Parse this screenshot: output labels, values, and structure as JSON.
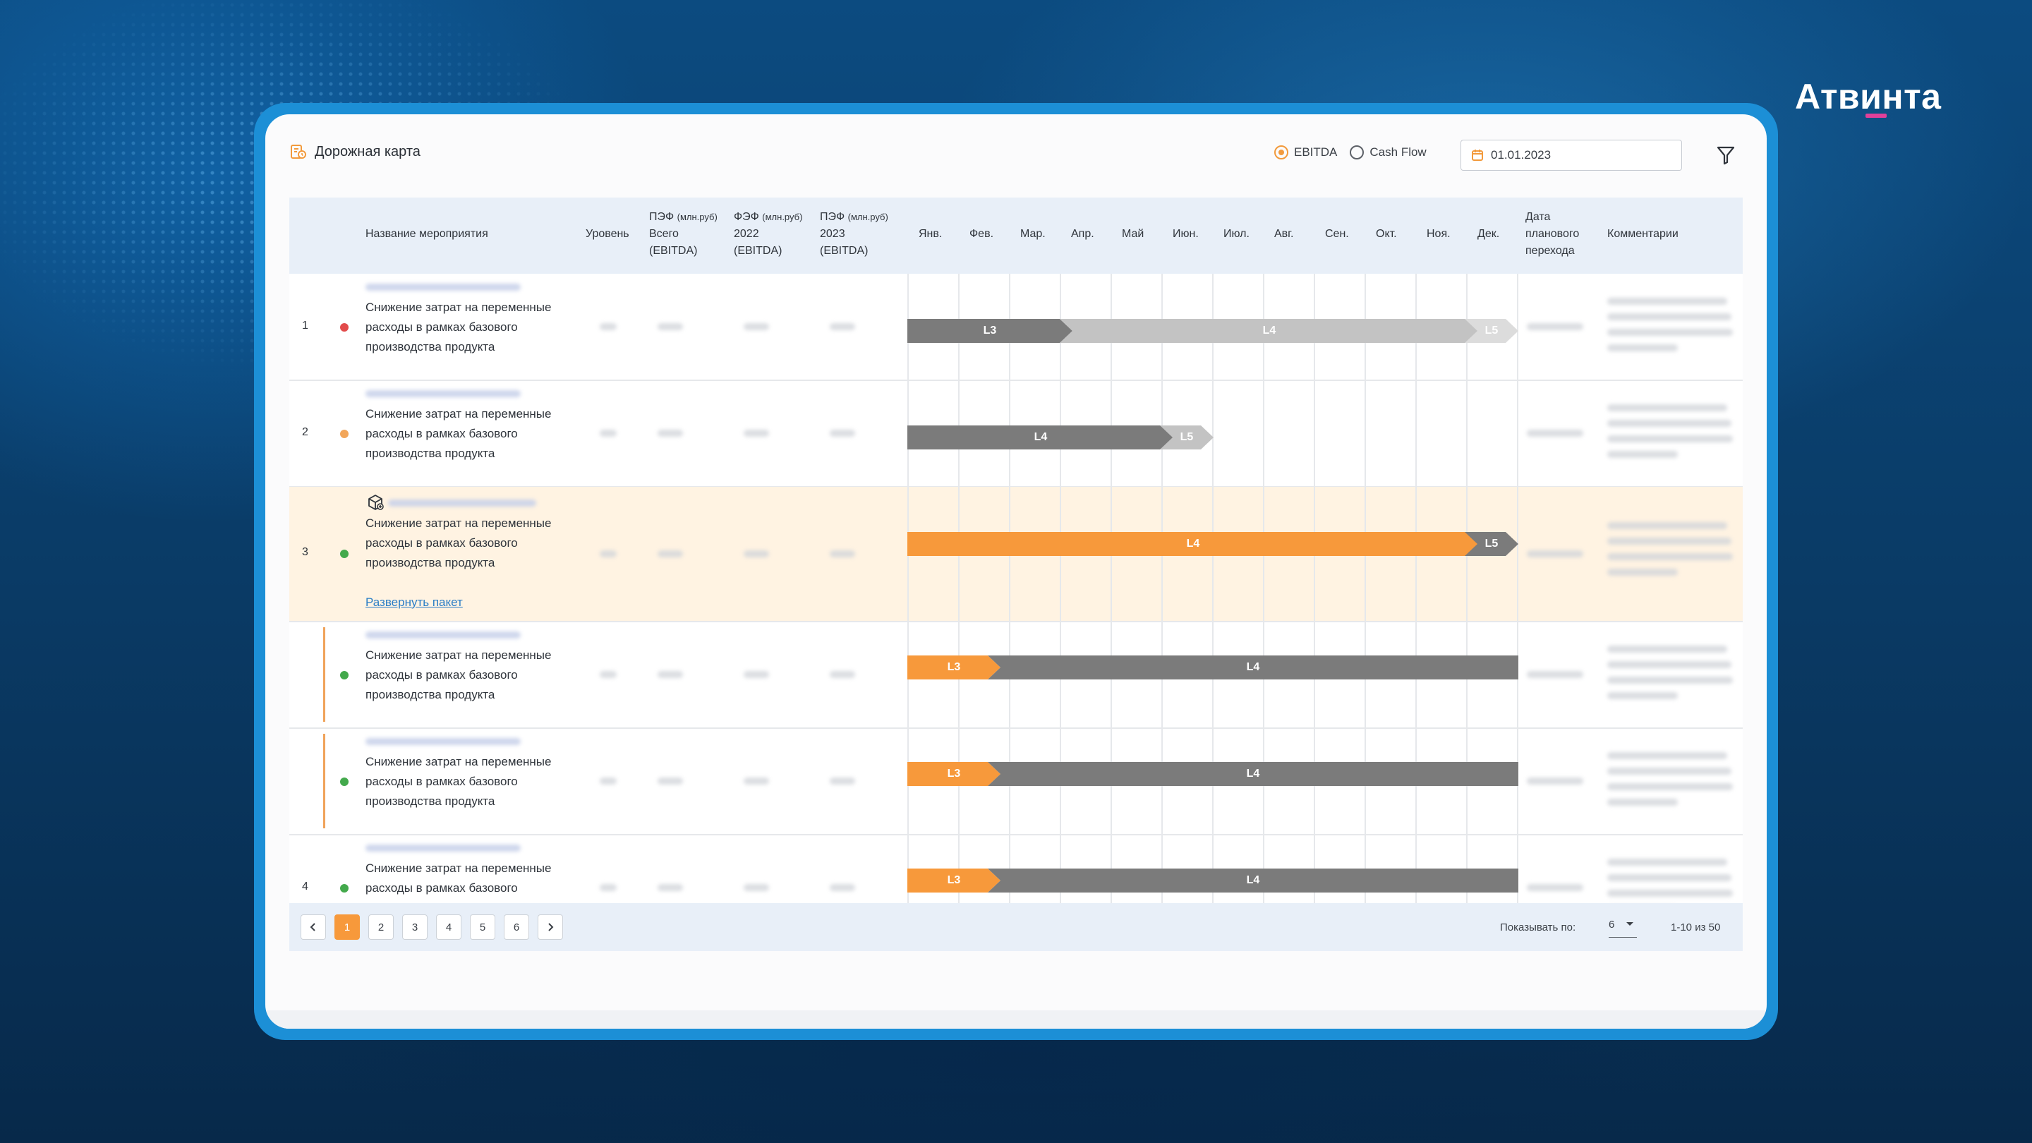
{
  "brand": {
    "logo_text": "Атвинта"
  },
  "header": {
    "title": "Дорожная карта",
    "radio_ebitda": "EBITDA",
    "radio_cashflow": "Cash Flow",
    "selected": "EBITDA",
    "date_value": "01.01.2023"
  },
  "columns": {
    "name": "Название мероприятия",
    "level": "Уровень",
    "pef_total_l1": "ПЭФ",
    "pef_total_unit": "(млн.руб)",
    "pef_total_l2": "Всего",
    "pef_total_l3": "(EBITDA)",
    "fef_2022_l1": "ФЭФ",
    "fef_2022_unit": "(млн.руб)",
    "fef_2022_l2": "2022",
    "fef_2022_l3": "(EBITDA)",
    "pef_2023_l1": "ПЭФ",
    "pef_2023_unit": "(млн.руб)",
    "pef_2023_l2": "2023",
    "pef_2023_l3": "(EBITDA)",
    "months": [
      "Янв.",
      "Фев.",
      "Мар.",
      "Апр.",
      "Май",
      "Июн.",
      "Июл.",
      "Авг.",
      "Сен.",
      "Окт.",
      "Ноя.",
      "Дек."
    ],
    "date_l1": "Дата",
    "date_l2": "планового",
    "date_l3": "перехода",
    "comments": "Комментарии"
  },
  "rows": [
    {
      "num": "1",
      "status": "red",
      "name": "Снижение затрат на переменные расходы в рамках базового производства продукта"
    },
    {
      "num": "2",
      "status": "orange",
      "name": "Снижение затрат на переменные расходы в рамках базового производства продукта"
    },
    {
      "num": "3",
      "status": "green",
      "name": "Снижение затрат на переменные расходы в рамках базового производства продукта",
      "link": "Развернуть пакет"
    },
    {
      "num": "",
      "status": "green",
      "name": "Снижение затрат на переменные расходы в рамках базового производства продукта"
    },
    {
      "num": "",
      "status": "green",
      "name": "Снижение затрат на переменные расходы в рамках базового производства продукта"
    },
    {
      "num": "4",
      "status": "green",
      "name": "Снижение затрат на переменные расходы в рамках базового производства продукта"
    }
  ],
  "gantt": {
    "levels": [
      "L3",
      "L4",
      "L5"
    ],
    "colors": {
      "dark": "#7b7b7b",
      "light": "#c3c3c3",
      "orange": "#f7993b"
    }
  },
  "pager": {
    "pages": [
      "1",
      "2",
      "3",
      "4",
      "5",
      "6"
    ],
    "current": "1",
    "show_label": "Показывать по:",
    "per_page": "6",
    "range": "1-10 из 50"
  },
  "status_colors": {
    "red": "#e24b4b",
    "orange": "#f2a65a",
    "green": "#43a94c"
  }
}
